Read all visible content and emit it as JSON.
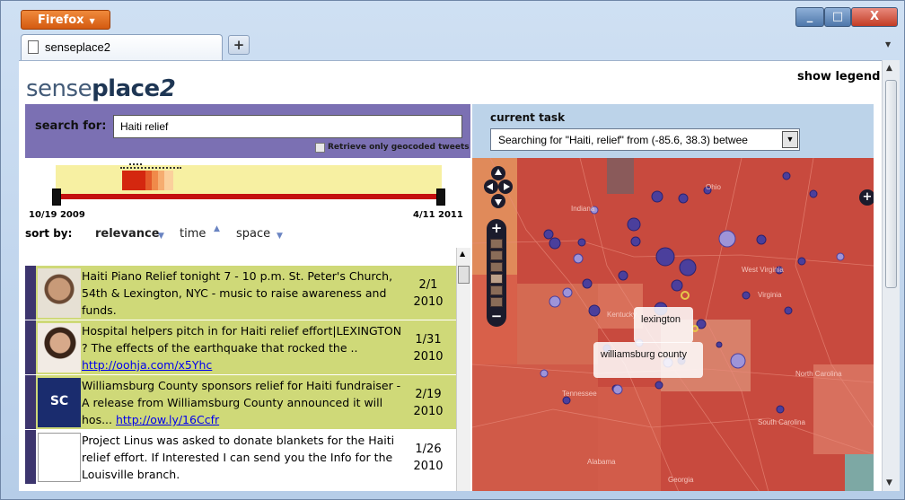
{
  "browser": {
    "app_button": "Firefox",
    "tab_title": "senseplace2",
    "new_tab_label": "+",
    "win_min": "_",
    "win_max": "□",
    "win_close": "X"
  },
  "app": {
    "logo_light": "sense",
    "logo_bold": "place",
    "logo_num": "2",
    "show_legend": "show legend"
  },
  "search": {
    "label": "search for:",
    "value": "Haiti relief",
    "geocoded_label": "Retrieve only geocoded tweets",
    "geocoded_checked": false
  },
  "timeline": {
    "start_date": "10/19 2009",
    "end_date": "4/11 2011"
  },
  "sort": {
    "label": "sort by:",
    "options": [
      "relevance",
      "time",
      "space"
    ],
    "active": "relevance"
  },
  "task": {
    "label": "current task",
    "value": "Searching for \"Haiti, relief\" from (-85.6, 38.3) betwee"
  },
  "tweets": [
    {
      "text": "Haiti Piano Relief tonight 7 - 10 p.m. St. Peter's Church, 54th & Lexington, NYC - music to raise awareness and funds.",
      "link": "",
      "date_line1": "2/1",
      "date_line2": "2010",
      "bg": "#cfd978"
    },
    {
      "text": "Hospital helpers pitch in for Haiti relief effort|LEXINGTON ? The effects of the earthquake that rocked the .. ",
      "link": "http://oohja.com/x5Yhc",
      "date_line1": "1/31",
      "date_line2": "2010",
      "bg": "#cfd978"
    },
    {
      "text": "Williamsburg County sponsors relief for Haiti fundraiser - A release from Williamsburg County announced it will hos... ",
      "link": "http://ow.ly/16Ccfr",
      "date_line1": "2/19",
      "date_line2": "2010",
      "bg": "#cfd978"
    },
    {
      "text": "Project Linus was asked to donate blankets for the Haiti relief effort. If Interested I can send you the Info for the Louisville branch.",
      "link": "",
      "date_line1": "1/26",
      "date_line2": "2010",
      "bg": "#ffffff"
    }
  ],
  "map": {
    "popup_lexington": "lexington",
    "popup_williamsburg": "williamsburg county",
    "place_labels": [
      "Indiana",
      "Ohio",
      "Virginia",
      "Kentucky",
      "Tennessee",
      "Alabama",
      "Georgia",
      "South Carolina",
      "West Virginia",
      "North Carolina"
    ]
  },
  "colors": {
    "search_panel": "#7b70b3",
    "task_panel": "#bcd3e9",
    "map_base": "#c84a3e",
    "marker": "#4b3f9c",
    "timeline_band": "#f7f0a2",
    "timeline_track": "#c40f0f"
  }
}
